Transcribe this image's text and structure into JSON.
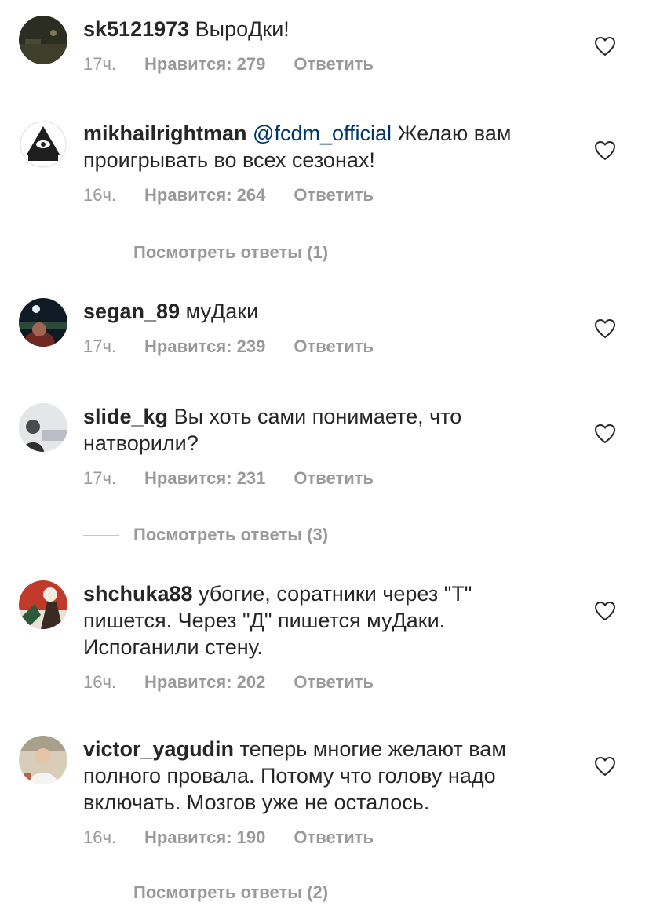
{
  "comments": [
    {
      "username": "sk5121973",
      "mention": "",
      "text": " ВыроДки!",
      "time": "17ч.",
      "likes": "Нравится: 279",
      "reply": "Ответить",
      "view_replies": "",
      "avatar_icon": "dark-night-photo-avatar"
    },
    {
      "username": "mikhailrightman",
      "mention": " @fcdm_official",
      "text": " Желаю вам проигрывать во всех сезонах!",
      "time": "16ч.",
      "likes": "Нравится: 264",
      "reply": "Ответить",
      "view_replies": "Посмотреть ответы (1)",
      "avatar_icon": "eye-pyramid-logo-avatar"
    },
    {
      "username": "segan_89",
      "mention": "",
      "text": " муДаки",
      "time": "17ч.",
      "likes": "Нравится: 239",
      "reply": "Ответить",
      "view_replies": "",
      "avatar_icon": "stadium-photo-avatar"
    },
    {
      "username": "slide_kg",
      "mention": "",
      "text": " Вы хоть сами понимаете, что натворили?",
      "time": "17ч.",
      "likes": "Нравится: 231",
      "reply": "Ответить",
      "view_replies": "Посмотреть ответы (3)",
      "avatar_icon": "person-photo-avatar"
    },
    {
      "username": "shchuka88",
      "mention": "",
      "text": " убогие, соратники через \"Т\" пишется. Через \"Д\" пишется муДаки. Испоганили стену.",
      "time": "16ч.",
      "likes": "Нравится: 202",
      "reply": "Ответить",
      "view_replies": "",
      "avatar_icon": "red-artwork-avatar"
    },
    {
      "username": "victor_yagudin",
      "mention": "",
      "text": " теперь многие желают вам полного провала. Потому что голову надо включать. Мозгов уже не осталось.",
      "time": "16ч.",
      "likes": "Нравится: 190",
      "reply": "Ответить",
      "view_replies": "Посмотреть ответы (2)",
      "avatar_icon": "person-photo-avatar"
    }
  ],
  "colors": {
    "text": "#262626",
    "meta": "#999999",
    "mention": "#003569",
    "divider": "#c7c7c7"
  }
}
